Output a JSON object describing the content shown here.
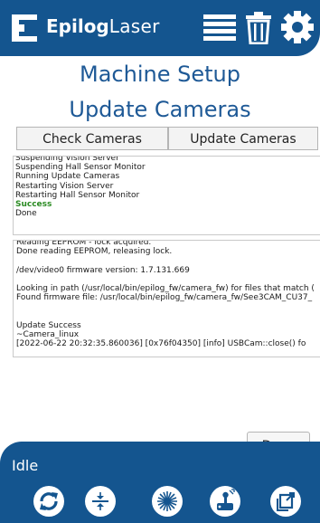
{
  "header": {
    "brand_bold": "Epilog",
    "brand_light": "Laser",
    "icons": [
      "logo-mark-icon",
      "menu-list-icon",
      "trash-icon",
      "gear-icon"
    ]
  },
  "title": "Machine Setup",
  "subtitle": "Update Cameras",
  "tabs": [
    {
      "label": "Check Cameras"
    },
    {
      "label": "Update Cameras"
    }
  ],
  "status_log": [
    "Suspending Vision Server",
    "Suspending Hall Sensor Monitor",
    "Running Update Cameras",
    "Restarting Vision Server",
    "Restarting Hall Sensor Monitor",
    "Success",
    "Done"
  ],
  "detail_log": [
    "Reading EEPROM - lock acquired.",
    "Done reading EEPROM, releasing lock.",
    "",
    "/dev/video0 firmware version: 1.7.131.669",
    "",
    "Looking in path (/usr/local/bin/epilog_fw/camera_fw) for files that match (",
    "Found firmware file: /usr/local/bin/epilog_fw/camera_fw/See3CAM_CU37_",
    "",
    "",
    "Update Success",
    "~Camera_linux",
    "[2022-06-22 20:32:35.860036] [0x76f04350] [info]   USBCam::close() fo"
  ],
  "done_label": "Done",
  "footer": {
    "status": "Idle",
    "buttons": [
      "refresh-icon",
      "focus-icon",
      "laser-burst-icon",
      "joystick-icon",
      "export-icon"
    ]
  },
  "colors": {
    "brand_blue": "#14558f",
    "title_blue": "#1e5996",
    "success_green": "#2a8b22"
  }
}
